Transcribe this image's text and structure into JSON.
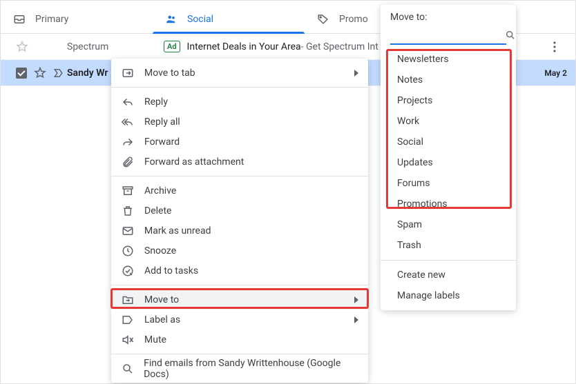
{
  "tabs": {
    "primary": "Primary",
    "social": "Social",
    "promotions": "Promo"
  },
  "ad": {
    "sender": "Spectrum",
    "badge": "Ad",
    "subject": "Internet Deals in Your Area",
    "snippet": " - Get Spectrum Int"
  },
  "email": {
    "sender": "Sandy Wr",
    "date": "May 2"
  },
  "contextMenu": {
    "moveToTab": "Move to tab",
    "reply": "Reply",
    "replyAll": "Reply all",
    "forward": "Forward",
    "forwardAttachment": "Forward as attachment",
    "archive": "Archive",
    "delete": "Delete",
    "markUnread": "Mark as unread",
    "snooze": "Snooze",
    "addTasks": "Add to tasks",
    "moveTo": "Move to",
    "labelAs": "Label as",
    "mute": "Mute",
    "findEmails": "Find emails from Sandy Writtenhouse (Google Docs)"
  },
  "movePanel": {
    "title": "Move to:",
    "labels": {
      "newsletters": "Newsletters",
      "notes": "Notes",
      "projects": "Projects",
      "work": "Work",
      "social": "Social",
      "updates": "Updates",
      "forums": "Forums",
      "promotions": "Promotions",
      "spam": "Spam",
      "trash": "Trash",
      "createNew": "Create new",
      "manageLabels": "Manage labels"
    }
  }
}
